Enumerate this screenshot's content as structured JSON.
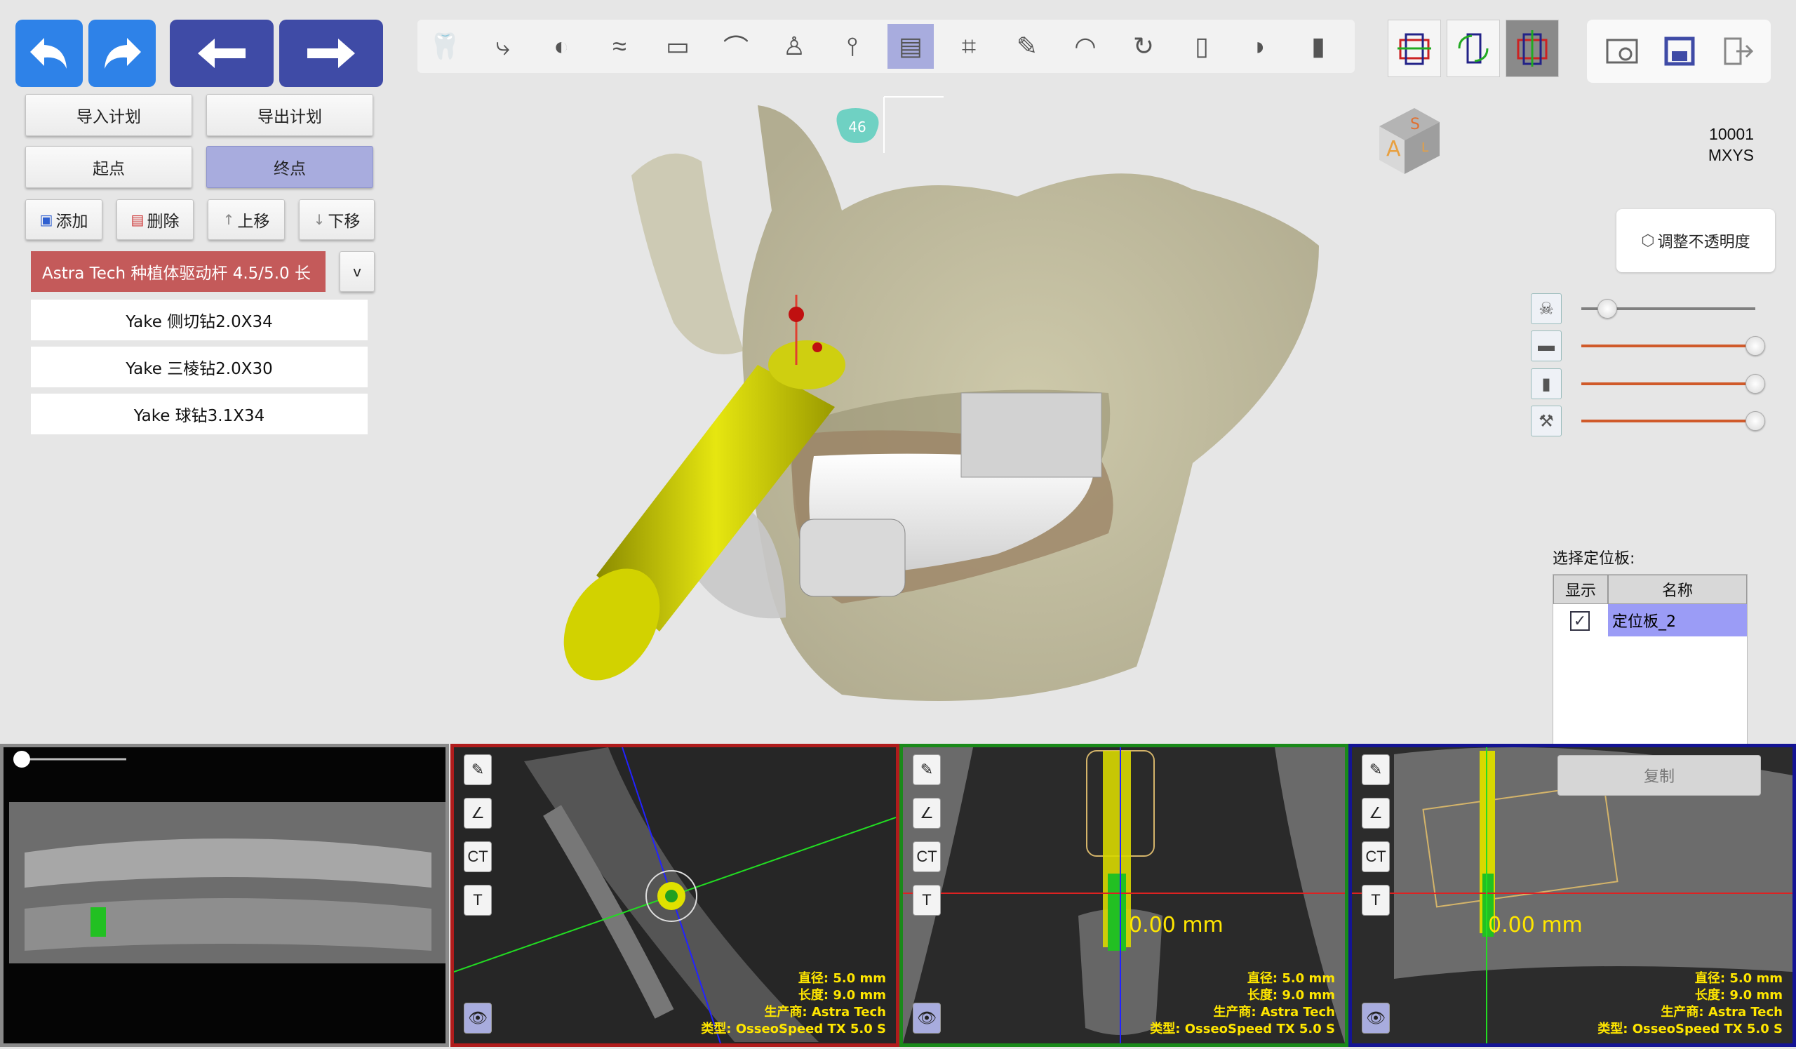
{
  "plan": {
    "import_label": "导入计划",
    "export_label": "导出计划",
    "start_label": "起点",
    "end_label": "终点",
    "add_label": "添加",
    "delete_label": "删除",
    "up_label": "上移",
    "down_label": "下移",
    "dropdown_label": "v"
  },
  "drills": [
    {
      "label": "Astra Tech 种植体驱动杆 4.5/5.0 长",
      "selected": true
    },
    {
      "label": "Yake 侧切钻2.0X34",
      "selected": false
    },
    {
      "label": "Yake 三棱钻2.0X30",
      "selected": false
    },
    {
      "label": "Yake 球钻3.1X34",
      "selected": false
    }
  ],
  "toolbar": {
    "icons": [
      "tooth-icon",
      "tooth-canal-icon",
      "root-canal-icon",
      "nerve-icon",
      "cross-section-icon",
      "arch-curve-icon",
      "crown-icon",
      "implant-icon",
      "report-icon",
      "crop-icon",
      "drill-icon",
      "gum-icon",
      "tooth-rotate-icon",
      "sleeve-icon",
      "bone-graft-icon",
      "implant-dark-icon"
    ],
    "active_index": 8
  },
  "scene": {
    "tooth_number": "46",
    "patient_id": "10001",
    "patient_name": "MXYS",
    "cube_top": "S",
    "cube_front": "A",
    "cube_side": "L"
  },
  "opacity": {
    "label": "调整不透明度"
  },
  "sliders": [
    {
      "icon": "skull-icon",
      "value": 0.15,
      "color": "#808080"
    },
    {
      "icon": "jaw-model-icon",
      "value": 1.0,
      "color": "#d05a2a"
    },
    {
      "icon": "implant-green-icon",
      "value": 1.0,
      "color": "#d05a2a"
    },
    {
      "icon": "drill-guide-icon",
      "value": 1.0,
      "color": "#d05a2a"
    }
  ],
  "guide": {
    "label": "选择定位板:",
    "col_show": "显示",
    "col_name": "名称",
    "rows": [
      {
        "checked": true,
        "name": "定位板_2"
      }
    ],
    "copy_label": "复制"
  },
  "panels": {
    "ct_label": "CT",
    "t_label": "T",
    "distance": "0.00 mm",
    "info": {
      "diameter": "直径: 5.0 mm",
      "length": "长度: 9.0 mm",
      "maker": "生产商: Astra Tech",
      "type": "类型: OsseoSpeed TX 5.0 S"
    }
  },
  "colors": {
    "nav_blue": "#2e82e8",
    "nav_indigo": "#3f4ba6",
    "active": "#a8acde",
    "selected_drill": "#c45a5a",
    "info_yellow": "#ffe600"
  }
}
